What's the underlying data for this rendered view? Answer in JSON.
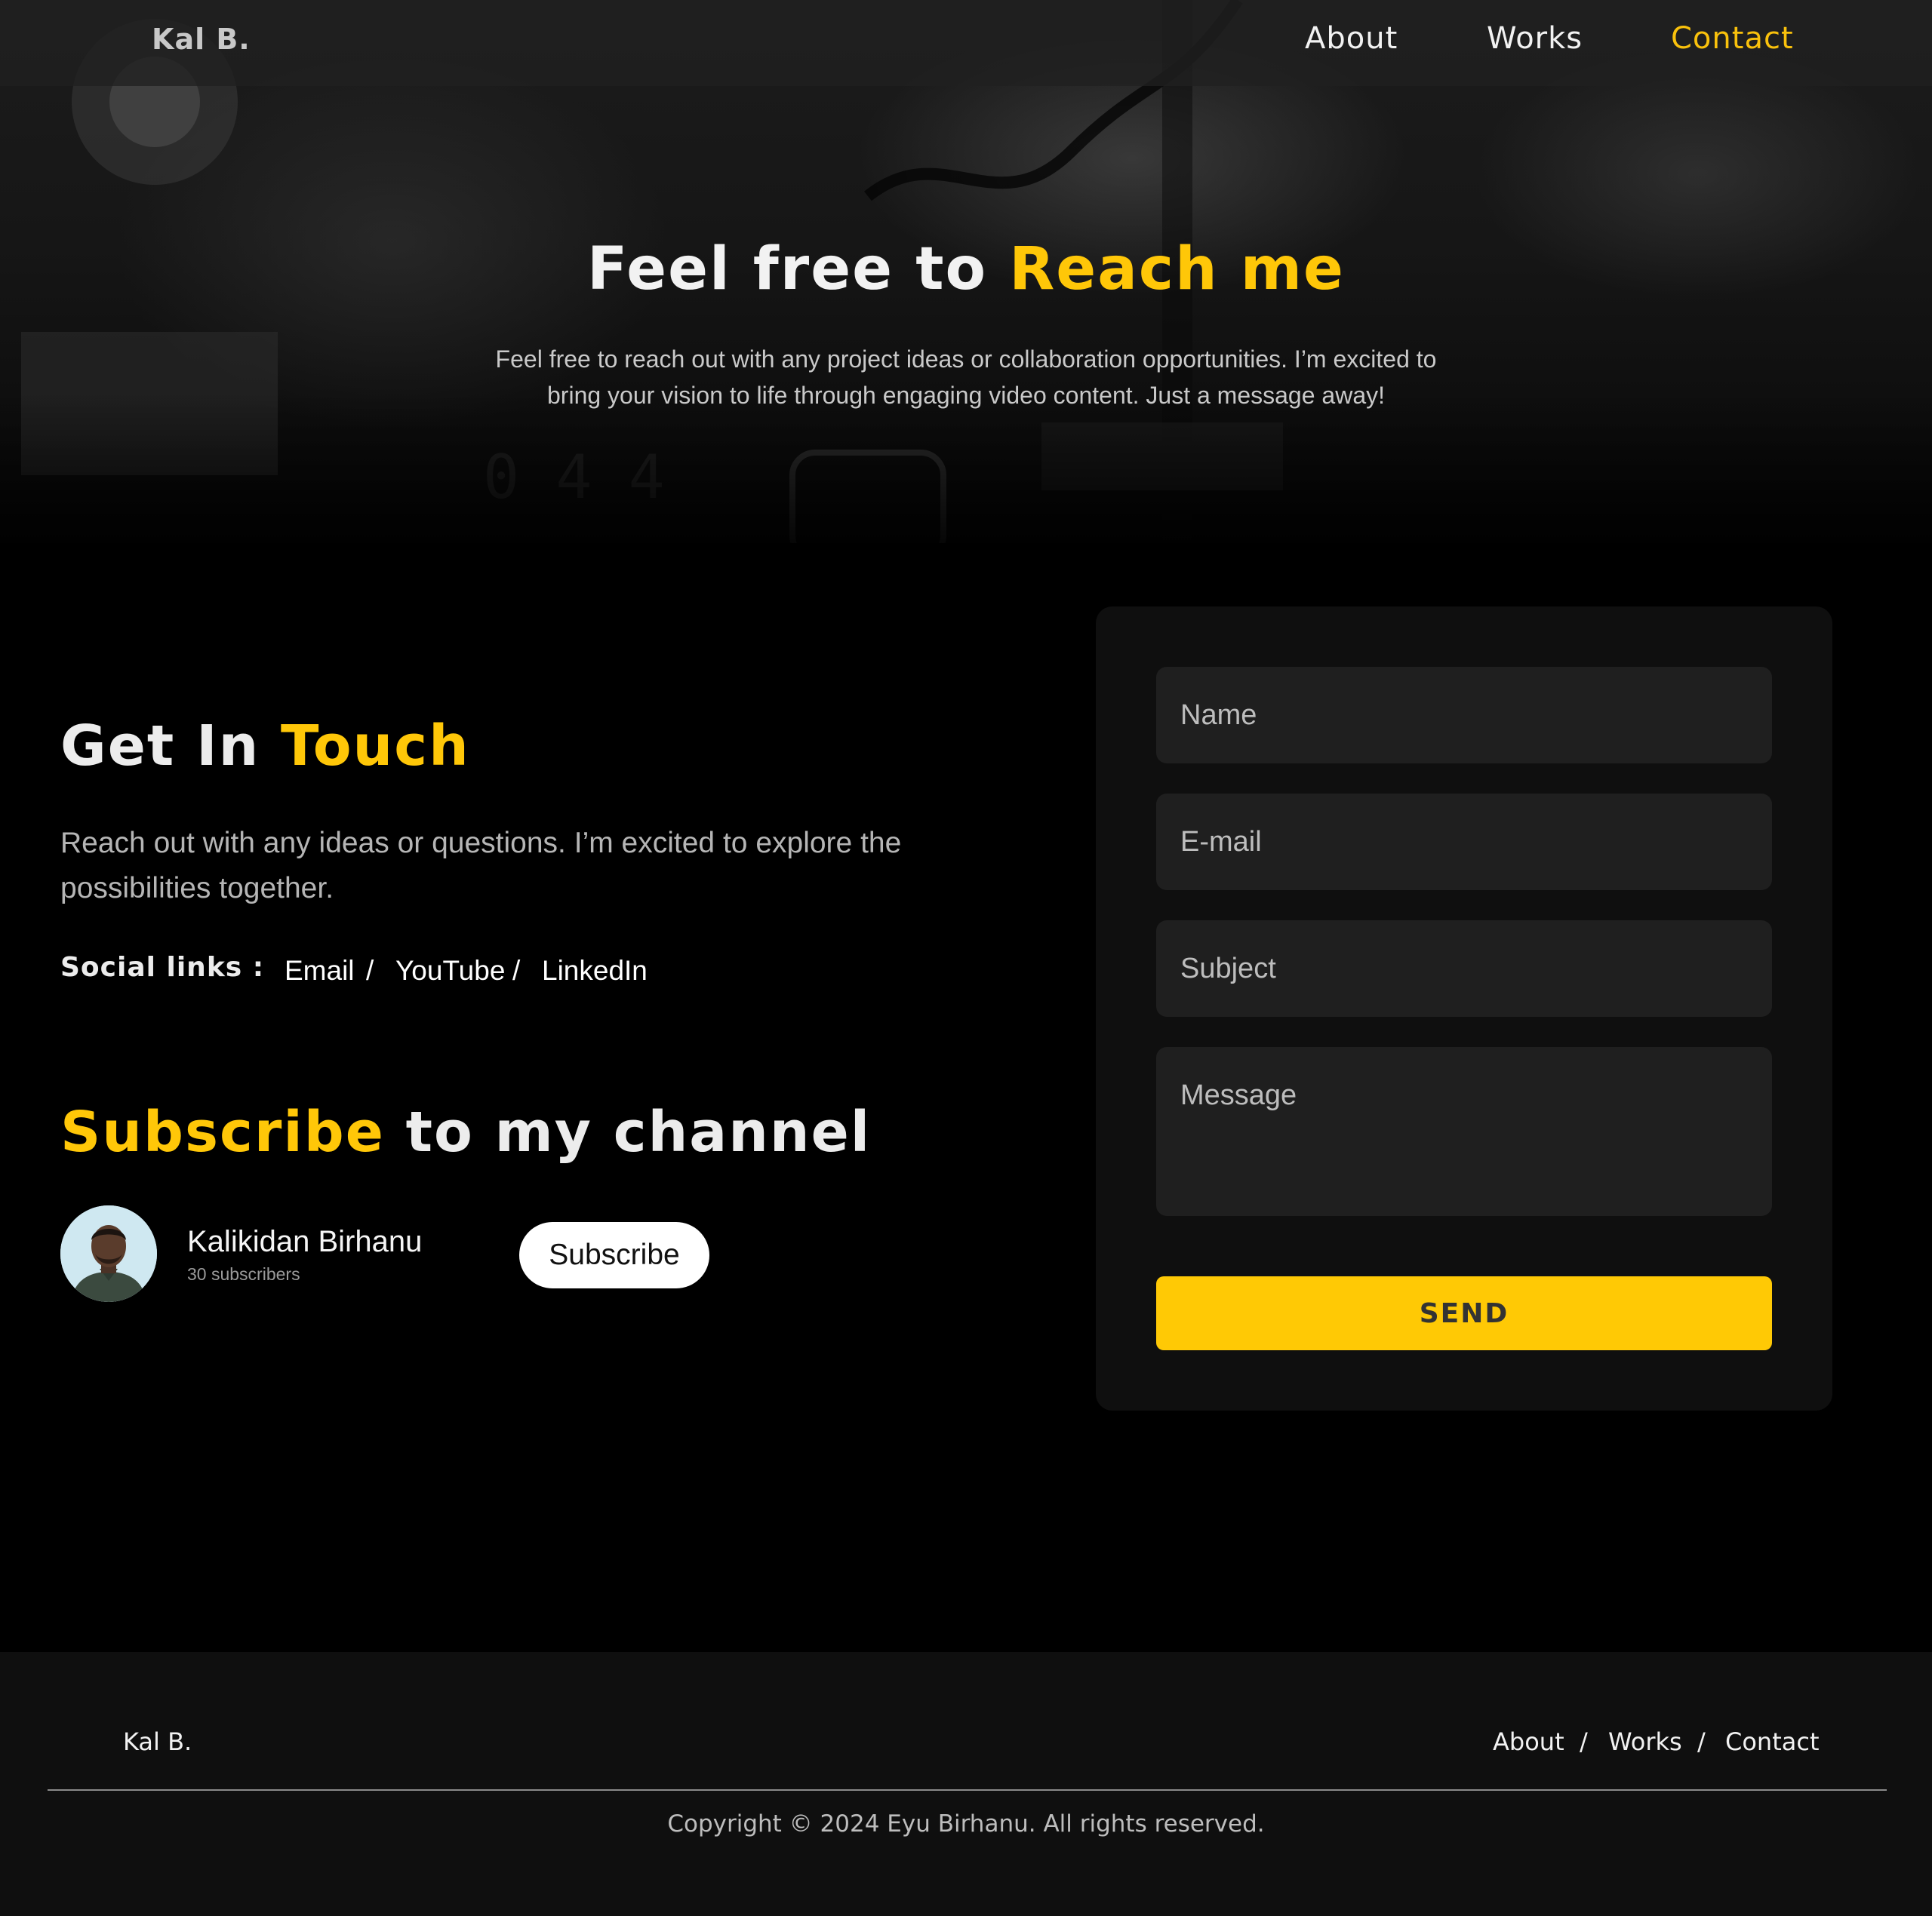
{
  "nav": {
    "logo": "Kal B.",
    "links": [
      {
        "label": "About"
      },
      {
        "label": "Works"
      },
      {
        "label": "Contact",
        "active": true
      }
    ]
  },
  "hero": {
    "title_prefix": "Feel free to ",
    "title_highlight": "Reach me",
    "subtitle": "Feel free to reach out with any project ideas or collaboration opportunities. I’m excited to bring your vision to life through engaging video content. Just a message away!"
  },
  "touch": {
    "title_prefix": "Get In ",
    "title_highlight": "Touch",
    "text": "Reach out with any ideas or questions. I’m excited to explore the possibilities together.",
    "social_label": "Social links :",
    "social_links": [
      "Email",
      "YouTube",
      "LinkedIn"
    ],
    "separator": "/"
  },
  "subscribe": {
    "title_highlight": "Subscribe",
    "title_suffix": " to my channel",
    "channel_name": "Kalikidan Birhanu",
    "subscribers": "30 subscribers",
    "button_label": "Subscribe"
  },
  "form": {
    "name_placeholder": "Name",
    "email_placeholder": "E-mail",
    "subject_placeholder": "Subject",
    "message_placeholder": "Message",
    "send_label": "SEND"
  },
  "footer": {
    "logo": "Kal B.",
    "links": [
      "About",
      "Works",
      "Contact"
    ],
    "separator": "/",
    "copyright": "Copyright © 2024 Eyu Birhanu. All rights reserved."
  },
  "colors": {
    "accent": "#ffc708",
    "background": "#000000",
    "card": "#0f0f0f",
    "field": "#1f1f1f"
  }
}
